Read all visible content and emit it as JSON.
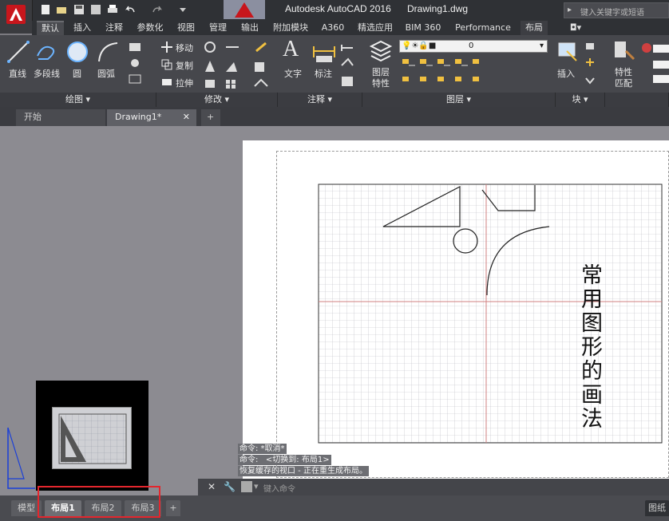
{
  "app": {
    "title": "Autodesk AutoCAD 2016",
    "file": "Drawing1.dwg",
    "search_placeholder": "键入关键字或短语"
  },
  "ribbon_tabs": [
    "默认",
    "插入",
    "注释",
    "参数化",
    "视图",
    "管理",
    "输出",
    "附加模块",
    "A360",
    "精选应用",
    "BIM 360",
    "Performance",
    "布局"
  ],
  "active_tab": "默认",
  "ribbon": {
    "draw": {
      "title": "绘图",
      "line": "直线",
      "polyline": "多段线",
      "circle": "圆",
      "arc": "圆弧"
    },
    "modify": {
      "title": "修改",
      "move": "移动",
      "copy": "复制",
      "stretch": "拉伸"
    },
    "annotation": {
      "title": "注释",
      "text": "文字",
      "dimension": "标注"
    },
    "layers": {
      "title": "图层",
      "properties_line1": "图层",
      "properties_line2": "特性",
      "current_layer": "0"
    },
    "block": {
      "title": "块",
      "insert": "插入"
    },
    "properties": {
      "match_line1": "特性",
      "match_line2": "匹配"
    }
  },
  "file_tabs": [
    {
      "label": "开始"
    },
    {
      "label": "Drawing1*"
    }
  ],
  "drawing": {
    "vertical_text": "常用图形的画法"
  },
  "command_history": [
    "命令: *取消*",
    "命令:   <切换到: 布局1>",
    "恢复缓存的视口 - 正在重生成布局。"
  ],
  "command_placeholder": "键入命令",
  "layout_tabs": [
    {
      "label": "模型",
      "active": false
    },
    {
      "label": "布局1",
      "active": true
    },
    {
      "label": "布局2",
      "active": false
    },
    {
      "label": "布局3",
      "active": false
    }
  ],
  "add_tab_symbol": "+",
  "status_right": "图纸",
  "colors": {
    "highlight": "#e3262d",
    "app_red": "#c8161c"
  }
}
